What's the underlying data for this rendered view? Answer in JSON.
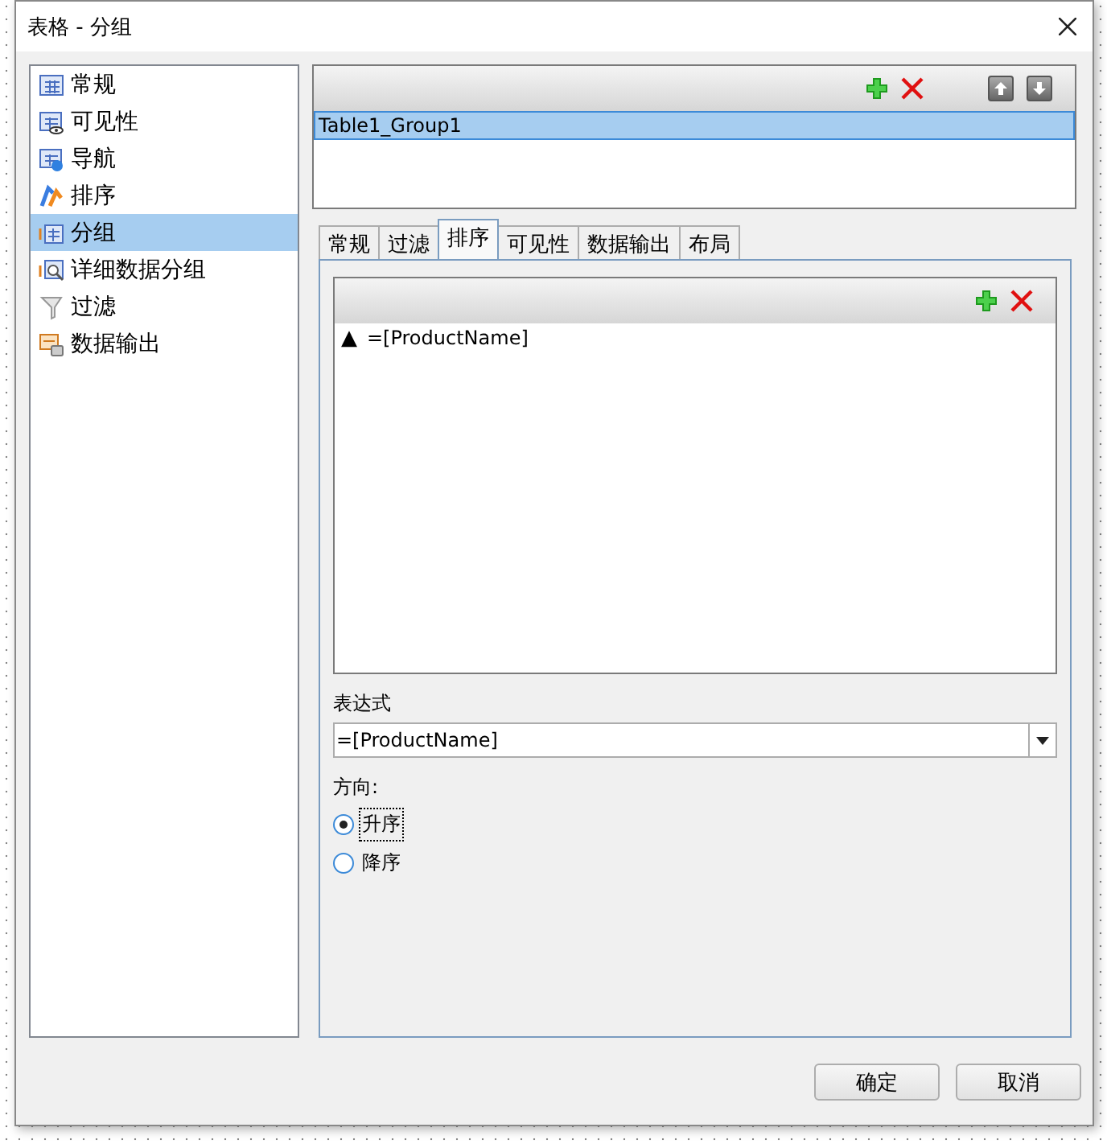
{
  "window": {
    "title": "表格 - 分组"
  },
  "sidebar": {
    "items": [
      {
        "label": "常规",
        "kind": "table",
        "selected": false
      },
      {
        "label": "可见性",
        "kind": "visibility",
        "selected": false
      },
      {
        "label": "导航",
        "kind": "navigation",
        "selected": false
      },
      {
        "label": "排序",
        "kind": "sort",
        "selected": false
      },
      {
        "label": "分组",
        "kind": "group",
        "selected": true
      },
      {
        "label": "详细数据分组",
        "kind": "detail",
        "selected": false
      },
      {
        "label": "过滤",
        "kind": "filter",
        "selected": false
      },
      {
        "label": "数据输出",
        "kind": "output",
        "selected": false
      }
    ]
  },
  "groups": {
    "items": [
      {
        "label": "Table1_Group1",
        "selected": true
      }
    ]
  },
  "tabs": [
    {
      "label": "常规",
      "selected": false
    },
    {
      "label": "过滤",
      "selected": false
    },
    {
      "label": "排序",
      "selected": true
    },
    {
      "label": "可见性",
      "selected": false
    },
    {
      "label": "数据输出",
      "selected": false
    },
    {
      "label": "布局",
      "selected": false
    }
  ],
  "sort_list": {
    "items": [
      {
        "marker": "▲",
        "expression": "=[ProductName]"
      }
    ]
  },
  "expression": {
    "label": "表达式",
    "value": "=[ProductName]"
  },
  "direction": {
    "label": "方向:",
    "options": [
      {
        "label": "升序",
        "selected": true
      },
      {
        "label": "降序",
        "selected": false
      }
    ]
  },
  "buttons": [
    "确定",
    "取消"
  ]
}
